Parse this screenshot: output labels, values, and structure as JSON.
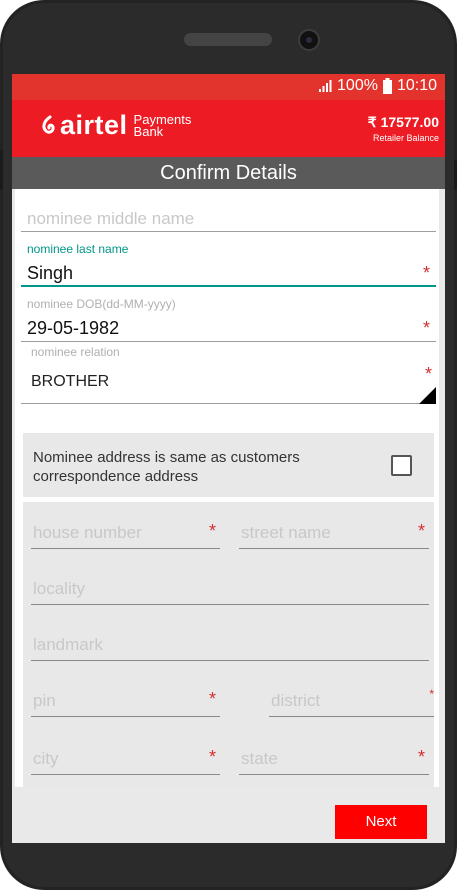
{
  "status_bar": {
    "battery": "100%",
    "time": "10:10"
  },
  "app_bar": {
    "brand": "airtel",
    "brand_sub_line1": "Payments",
    "brand_sub_line2": "Bank",
    "balance_amount": "₹ 17577.00",
    "balance_label": "Retailer Balance"
  },
  "title": "Confirm Details",
  "form": {
    "middle_name": {
      "placeholder": "nominee middle name",
      "value": ""
    },
    "last_name": {
      "label": "nominee last name",
      "value": "Singh",
      "required": "*"
    },
    "dob": {
      "label": "nominee DOB(dd-MM-yyyy)",
      "value": "29-05-1982",
      "required": "*"
    },
    "relation": {
      "label": "nominee relation",
      "value": "BROTHER",
      "required": "*"
    },
    "same_address": {
      "label": "Nominee address is same as customers correspondence address",
      "checked": false
    },
    "address": {
      "house_number": {
        "placeholder": "house number",
        "required": "*"
      },
      "street_name": {
        "placeholder": "street name",
        "required": "*"
      },
      "locality": {
        "placeholder": "locality"
      },
      "landmark": {
        "placeholder": "landmark"
      },
      "pin": {
        "placeholder": "pin",
        "required": "*"
      },
      "district": {
        "placeholder": "district",
        "required": "*"
      },
      "city": {
        "placeholder": "city",
        "required": "*"
      },
      "state": {
        "placeholder": "state",
        "required": "*"
      }
    }
  },
  "next_button": "Next",
  "colors": {
    "primary_red": "#ed1c24",
    "status_red": "#e2342c",
    "accent_teal": "#009688",
    "title_gray": "#5a5a5a"
  }
}
